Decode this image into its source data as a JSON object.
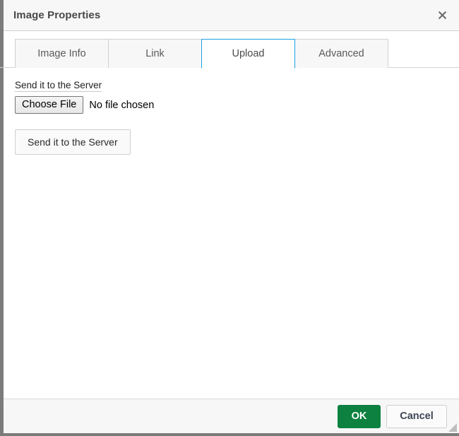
{
  "dialog": {
    "title": "Image Properties",
    "close_icon": "close-icon",
    "close_glyph": "✕"
  },
  "tabs": [
    {
      "label": "Image Info",
      "active": false
    },
    {
      "label": "Link",
      "active": false
    },
    {
      "label": "Upload",
      "active": true
    },
    {
      "label": "Advanced",
      "active": false
    }
  ],
  "upload_panel": {
    "field_label": "Send it to the Server",
    "file_input": {
      "button_label": "Choose File",
      "status_text": "No file chosen",
      "value": ""
    },
    "submit_label": "Send it to the Server"
  },
  "footer": {
    "ok_label": "OK",
    "cancel_label": "Cancel",
    "resize_grip_icon": "resize-grip-icon"
  },
  "colors": {
    "accent_tab_blue": "#1ba1e2",
    "ok_green": "#0d8140",
    "header_bg": "#f7f7f7",
    "border_gray": "#d1d1d1",
    "window_edge": "#7b7b7b"
  }
}
